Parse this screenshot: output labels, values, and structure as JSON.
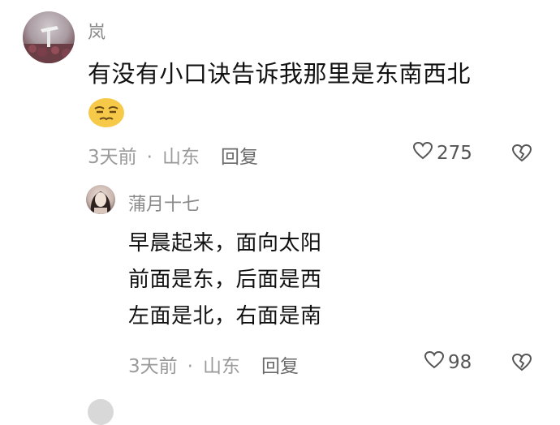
{
  "comment": {
    "author": "岚",
    "text": "有没有小口诀告诉我那里是东南西北",
    "emoji_icon": "smirk-face-emoji",
    "time": "3天前",
    "separator": "·",
    "location": "山东",
    "reply_label": "回复",
    "likes": "275"
  },
  "reply": {
    "author": "蒲月十七",
    "lines": [
      "早晨起来，面向太阳",
      "前面是东，后面是西",
      "左面是北，右面是南"
    ],
    "time": "3天前",
    "separator": "·",
    "location": "山东",
    "reply_label": "回复",
    "likes": "98"
  },
  "colors": {
    "meta": "#9a9a9a",
    "author": "#8a8a8a",
    "emoji": "#f7c948"
  }
}
